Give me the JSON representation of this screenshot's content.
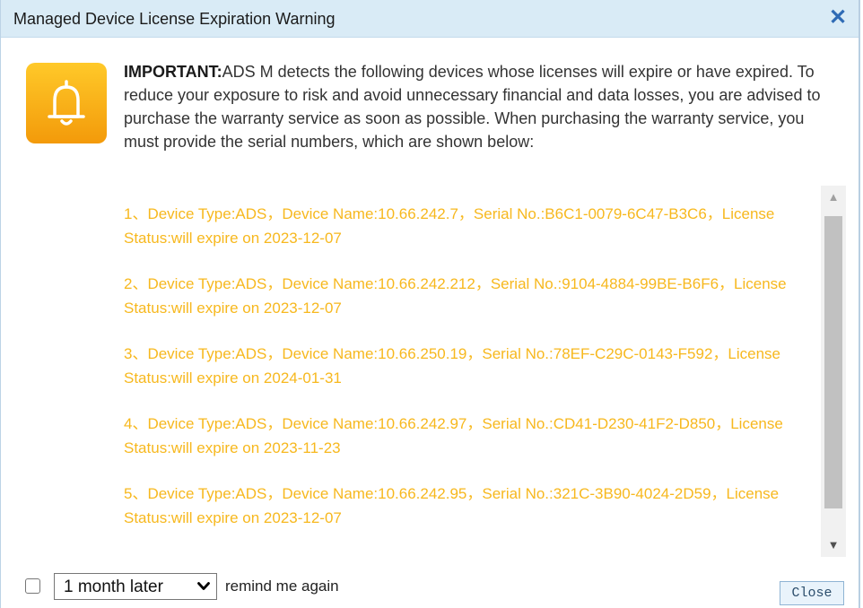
{
  "dialog": {
    "title": "Managed Device License Expiration Warning",
    "close_symbol": "✕"
  },
  "icon": {
    "name": "bell-icon",
    "gradient_top": "#ffc929",
    "gradient_bottom": "#f39a0a"
  },
  "message": {
    "prefix": "IMPORTANT:",
    "body": "ADS M detects the following devices whose licenses will expire or have expired. To reduce your exposure to risk and avoid unnecessary financial and data losses, you are advised to purchase the warranty service as soon as possible. When purchasing the warranty service, you must provide the serial numbers, which are shown below:"
  },
  "devices": [
    "1、Device Type:ADS，Device Name:10.66.242.7，Serial No.:B6C1-0079-6C47-B3C6，License Status:will expire on 2023-12-07",
    "2、Device Type:ADS，Device Name:10.66.242.212，Serial No.:9104-4884-99BE-B6F6，License Status:will expire on 2023-12-07",
    "3、Device Type:ADS，Device Name:10.66.250.19，Serial No.:78EF-C29C-0143-F592，License Status:will expire on 2024-01-31",
    "4、Device Type:ADS，Device Name:10.66.242.97，Serial No.:CD41-D230-41F2-D850，License Status:will expire on 2023-11-23",
    "5、Device Type:ADS，Device Name:10.66.242.95，Serial No.:321C-3B90-4024-2D59，License Status:will expire on 2023-12-07"
  ],
  "colors": {
    "device_text": "#f7b81e",
    "title_bar": "#d9ebf6",
    "close_icon": "#2f6bb5"
  },
  "footer": {
    "checkbox_checked": false,
    "remind_select_value": "1 month later",
    "remind_label": "remind me again",
    "close_button": "Close"
  }
}
